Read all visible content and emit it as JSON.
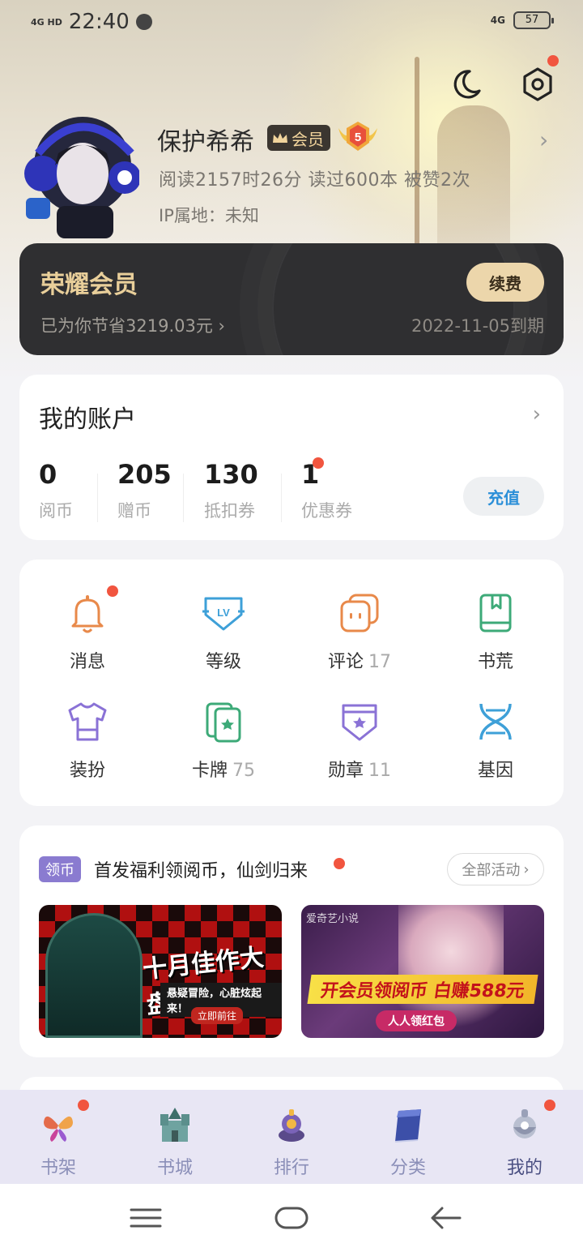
{
  "status_bar": {
    "signal": "4G HD",
    "time": "22:40",
    "network": "4G",
    "battery": "57"
  },
  "profile": {
    "name": "保护希希",
    "vip_badge": "会员",
    "level": "5",
    "reading_stats": "阅读2157时26分  读过600本  被赞2次",
    "ip_location": "IP属地：未知"
  },
  "vip_card": {
    "title": "荣耀会员",
    "saved": "已为你节省3219.03元 ›",
    "renew_label": "续费",
    "expire": "2022-11-05到期"
  },
  "account": {
    "title": "我的账户",
    "items": [
      {
        "value": "0",
        "label": "阅币"
      },
      {
        "value": "205",
        "label": "赠币"
      },
      {
        "value": "130",
        "label": "抵扣券"
      },
      {
        "value": "1",
        "label": "优惠券"
      }
    ],
    "recharge_label": "充值"
  },
  "grid": {
    "items": [
      {
        "label": "消息",
        "count": "",
        "icon": "bell-icon",
        "color": "#e8894a"
      },
      {
        "label": "等级",
        "count": "",
        "icon": "level-icon",
        "color": "#3ea0d8"
      },
      {
        "label": "评论",
        "count": "17",
        "icon": "comment-icon",
        "color": "#e8894a"
      },
      {
        "label": "书荒",
        "count": "",
        "icon": "bookmark-book-icon",
        "color": "#3daa78"
      },
      {
        "label": "装扮",
        "count": "",
        "icon": "tshirt-icon",
        "color": "#8a72d6"
      },
      {
        "label": "卡牌",
        "count": "75",
        "icon": "cards-icon",
        "color": "#3daa78"
      },
      {
        "label": "勋章",
        "count": "11",
        "icon": "medal-icon",
        "color": "#8a72d6"
      },
      {
        "label": "基因",
        "count": "",
        "icon": "dna-icon",
        "color": "#3ea0d8"
      }
    ]
  },
  "activity": {
    "tag": "领币",
    "title": "首发福利领阅币，仙剑归来",
    "all_label": "全部活动",
    "banners": [
      {
        "headline": "十月佳作大盘点",
        "sub": "悬疑冒险，心脏炫起来！",
        "cta": "立即前往"
      },
      {
        "brand": "爱奇艺小说",
        "headline": "开会员领阅币 白赚588元",
        "cta": "人人领红包"
      }
    ]
  },
  "bottom_nav": {
    "items": [
      {
        "label": "书架",
        "icon": "bookshelf-butterfly-icon"
      },
      {
        "label": "书城",
        "icon": "bookstore-castle-icon"
      },
      {
        "label": "排行",
        "icon": "ranking-icon"
      },
      {
        "label": "分类",
        "icon": "category-book-icon"
      },
      {
        "label": "我的",
        "icon": "mine-icon"
      }
    ]
  },
  "colors": {
    "accent_red": "#f1553f",
    "vip_gold": "#e9cf9a",
    "recharge_blue": "#2b8fd8"
  }
}
